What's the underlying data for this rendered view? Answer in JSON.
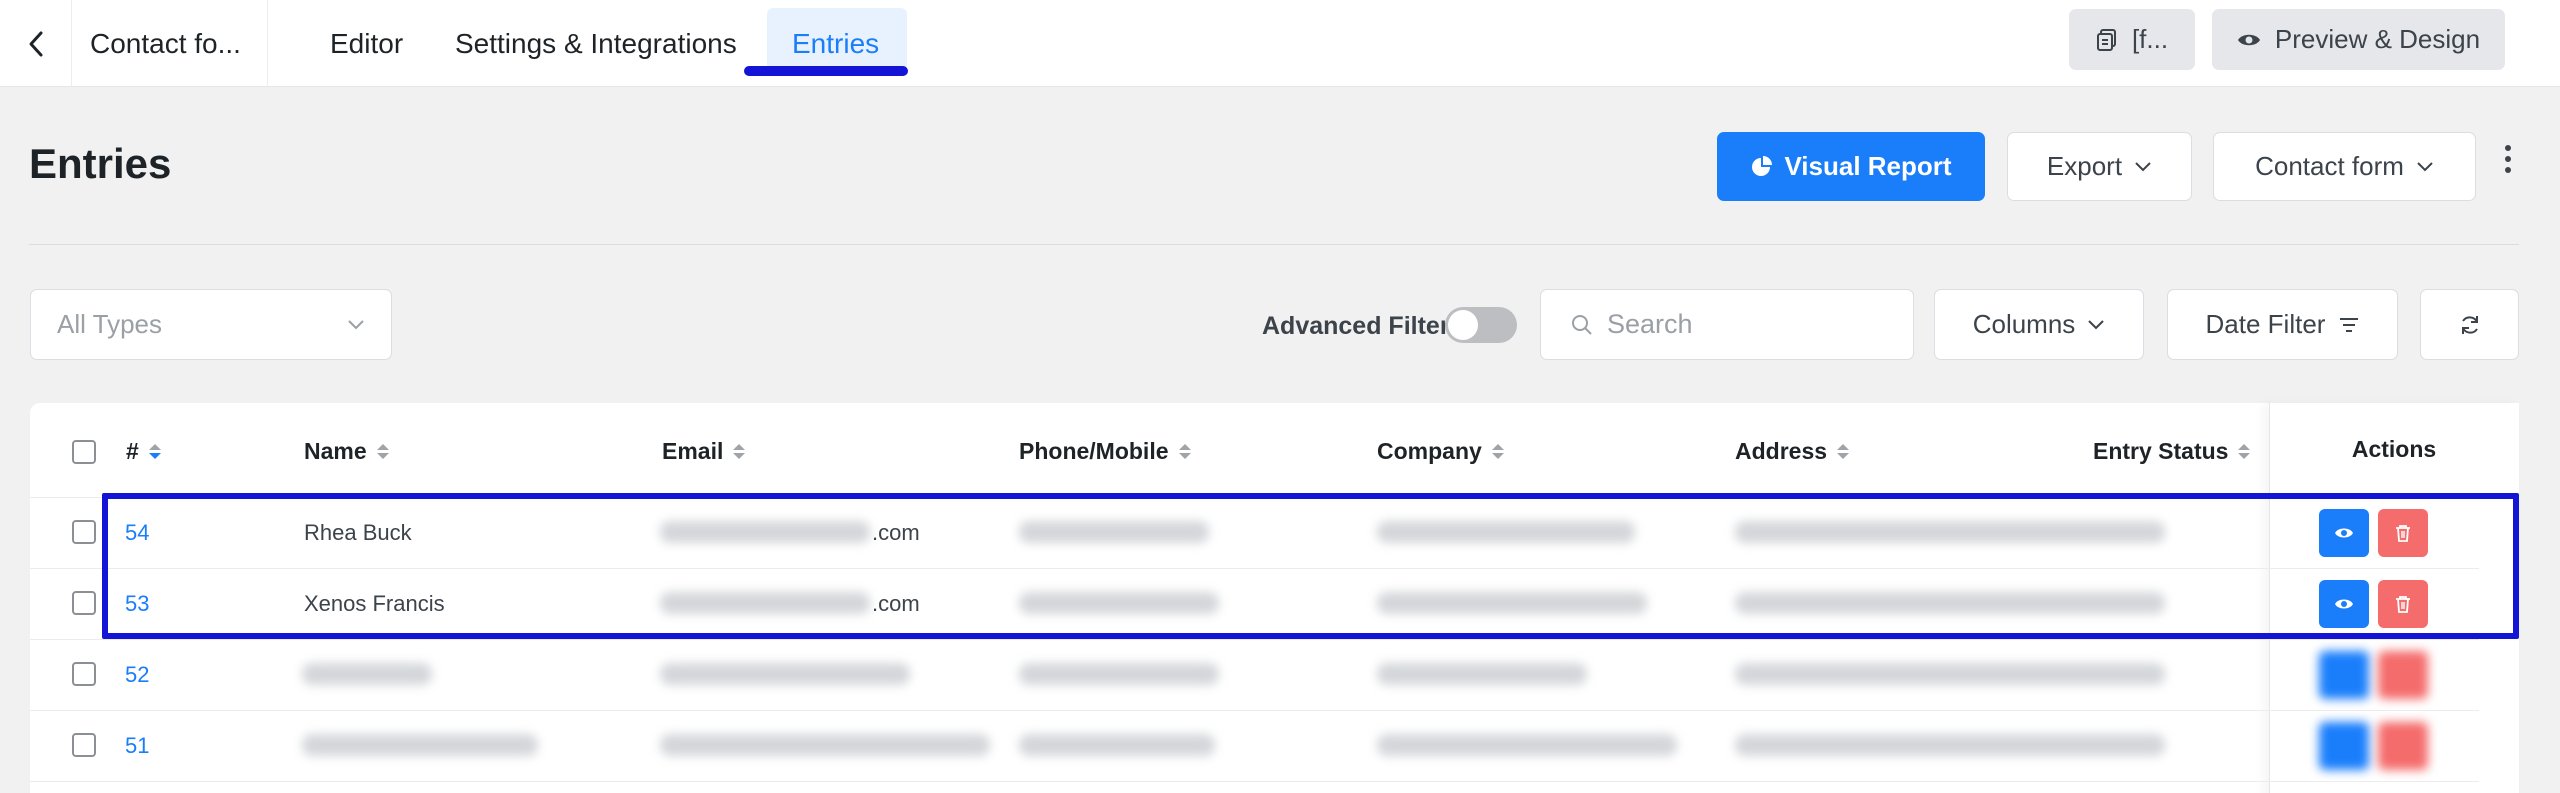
{
  "topbar": {
    "form_name": "Contact fo...",
    "tabs": [
      {
        "label": "Editor"
      },
      {
        "label": "Settings & Integrations"
      },
      {
        "label": "Entries",
        "active": true
      }
    ],
    "shortcode_button": "[f...",
    "preview_button": "Preview & Design"
  },
  "header": {
    "title": "Entries",
    "visual_report": "Visual Report",
    "export": "Export",
    "form_select": "Contact form"
  },
  "filters": {
    "type_select": "All Types",
    "advanced_filter_label": "Advanced Filter",
    "advanced_filter_on": false,
    "search_placeholder": "Search",
    "columns": "Columns",
    "date_filter": "Date Filter"
  },
  "table": {
    "columns": [
      "#",
      "Name",
      "Email",
      "Phone/Mobile",
      "Company",
      "Address",
      "Entry Status",
      "Actions"
    ],
    "rows": [
      {
        "id": "54",
        "name": "Rhea Buck",
        "email_suffix": ".com"
      },
      {
        "id": "53",
        "name": "Xenos Francis",
        "email_suffix": ".com"
      },
      {
        "id": "52"
      },
      {
        "id": "51"
      }
    ]
  },
  "colors": {
    "accent": "#1a7efb",
    "highlight": "#1414d6",
    "delete": "#f56c6c"
  }
}
